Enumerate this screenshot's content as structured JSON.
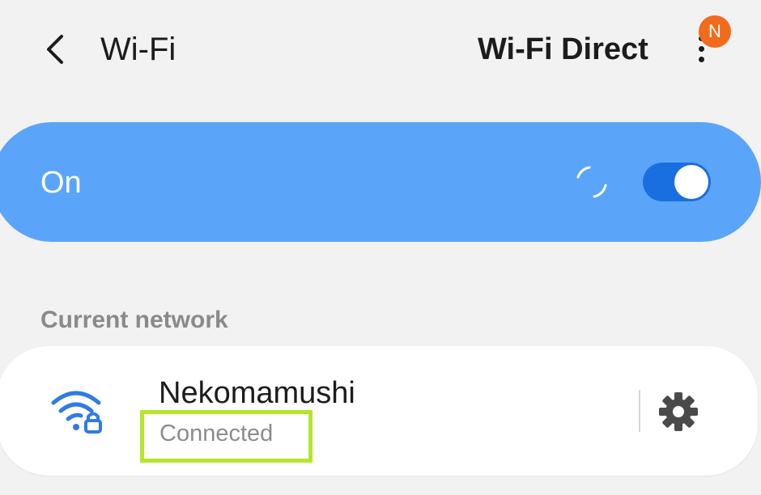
{
  "header": {
    "title": "Wi-Fi",
    "wifi_direct_label": "Wi-Fi Direct",
    "notification_badge": "N"
  },
  "master_toggle": {
    "label": "On",
    "state": "on"
  },
  "current_network_section": {
    "title": "Current network",
    "network": {
      "name": "Nekomamushi",
      "status": "Connected",
      "icon": "wifi-lock-icon",
      "settings_icon": "gear-icon"
    }
  },
  "colors": {
    "background": "#f2f2f2",
    "toggle_bar": "#5aa5fa",
    "switch_on": "#1a6fe0",
    "badge": "#f26a1b",
    "wifi_icon": "#2f7be6",
    "highlight": "#b5e62a",
    "gear": "#4a4a4a"
  }
}
